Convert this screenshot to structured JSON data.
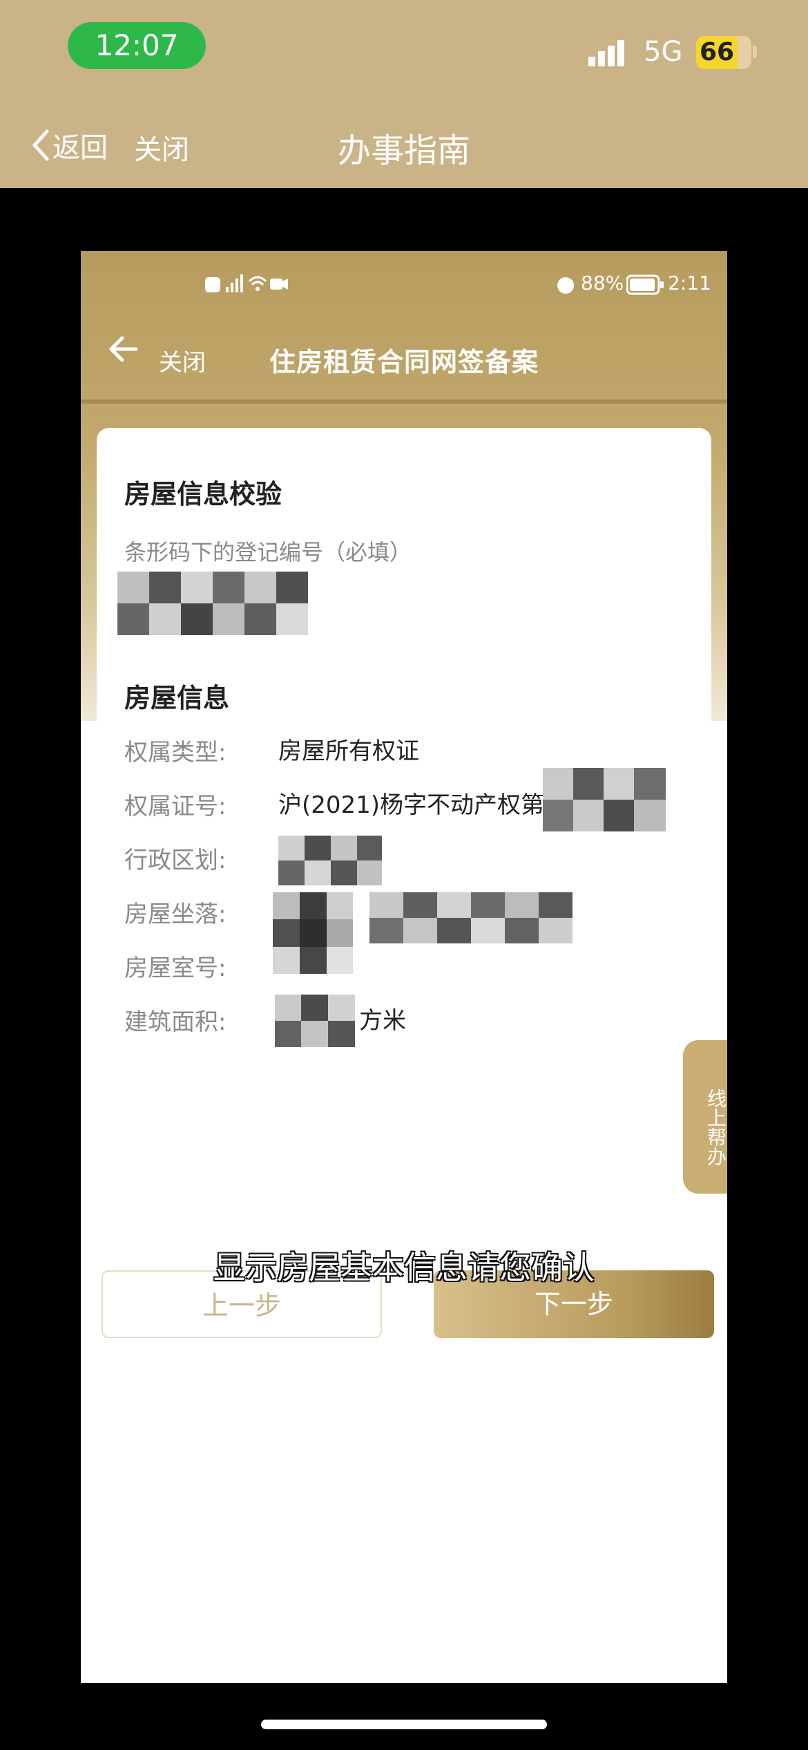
{
  "status_bar": {
    "time": "12:07",
    "network": "5G",
    "battery": "66"
  },
  "outer_nav": {
    "back_label": "返回",
    "close_label": "关闭",
    "title": "办事指南"
  },
  "inner_status": {
    "battery_percent": "88%",
    "time": "2:11"
  },
  "inner_nav": {
    "close_label": "关闭",
    "title": "住房租赁合同网签备案"
  },
  "verify_section": {
    "heading": "房屋信息校验",
    "field_label": "条形码下的登记编号（必填）"
  },
  "info_section": {
    "heading": "房屋信息",
    "rows": [
      {
        "label": "权属类型:",
        "value": "房屋所有权证"
      },
      {
        "label": "权属证号:",
        "value": "沪(2021)杨字不动产权第"
      },
      {
        "label": "行政区划:",
        "value": ""
      },
      {
        "label": "房屋坐落:",
        "value": ""
      },
      {
        "label": "房屋室号:",
        "value": ""
      },
      {
        "label": "建筑面积:",
        "value": "方米"
      }
    ]
  },
  "side_tab": {
    "label": "线上帮办"
  },
  "caption": "显示房屋基本信息请您确认",
  "buttons": {
    "prev": "上一步",
    "next": "下一步"
  },
  "colors": {
    "header_gold": "#cbb388",
    "time_pill": "#2fb84a",
    "accent_gold": "#b89a5c"
  }
}
